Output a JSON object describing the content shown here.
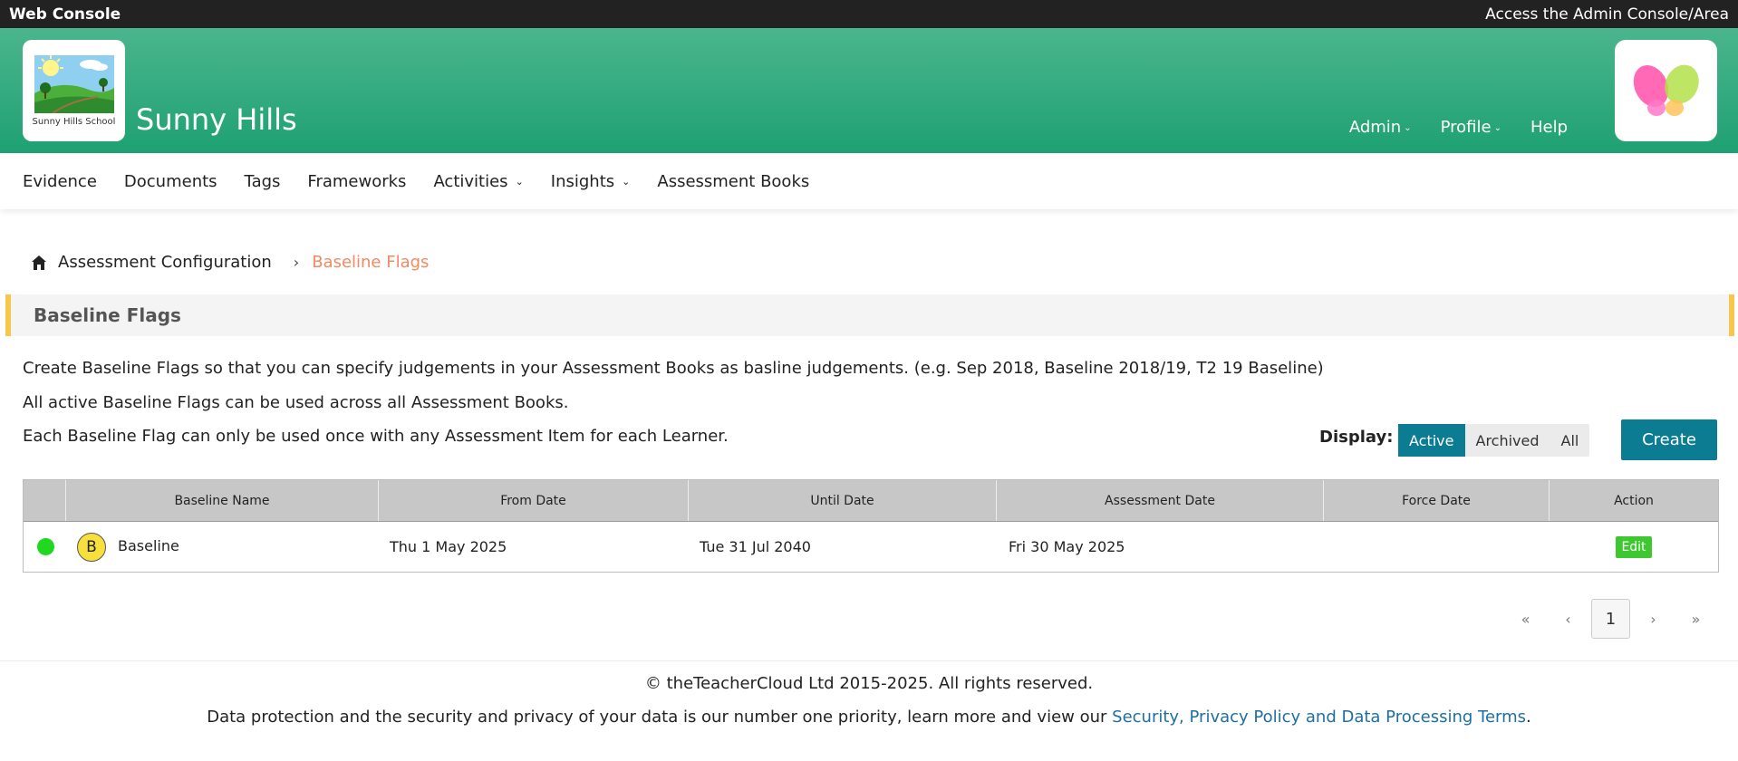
{
  "topbar": {
    "left_label": "Web Console",
    "right_link": "Access the Admin Console/Area"
  },
  "header": {
    "logo_caption": "Sunny Hills School",
    "school_name": "Sunny Hills",
    "nav": [
      {
        "label": "Admin",
        "icon": "chevron-down-icon"
      },
      {
        "label": "Profile",
        "icon": "chevron-down-icon"
      },
      {
        "label": "Help"
      }
    ],
    "brand_icon": "butterfly-logo-icon"
  },
  "main_nav": [
    {
      "label": "Evidence"
    },
    {
      "label": "Documents"
    },
    {
      "label": "Tags"
    },
    {
      "label": "Frameworks"
    },
    {
      "label": "Activities",
      "icon": "chevron-down-icon"
    },
    {
      "label": "Insights",
      "icon": "chevron-down-icon"
    },
    {
      "label": "Assessment Books"
    }
  ],
  "breadcrumb": {
    "home_icon": "home-icon",
    "parent": "Assessment Configuration",
    "separator": "›",
    "current": "Baseline Flags"
  },
  "panel": {
    "title": "Baseline Flags"
  },
  "description": [
    "Create Baseline Flags so that you can specify judgements in your Assessment Books as basline judgements. (e.g. Sep 2018, Baseline 2018/19, T2 19 Baseline)",
    "All active Baseline Flags can be used across all Assessment Books.",
    "Each Baseline Flag can only be used once with any Assessment Item for each Learner."
  ],
  "display_filter": {
    "label": "Display:",
    "options": [
      "Active",
      "Archived",
      "All"
    ],
    "selected": "Active"
  },
  "create_label": "Create",
  "table": {
    "columns": [
      "",
      "Baseline Name",
      "From Date",
      "Until Date",
      "Assessment Date",
      "Force Date",
      "Action"
    ],
    "rows": [
      {
        "status_color": "#1fd81f",
        "badge": "B",
        "name": "Baseline",
        "from": "Thu 1 May 2025",
        "until": "Tue 31 Jul 2040",
        "assessment": "Fri 30 May 2025",
        "force": "",
        "action": "Edit"
      }
    ]
  },
  "pagination": {
    "first": "«",
    "prev": "‹",
    "current": "1",
    "next": "›",
    "last": "»"
  },
  "footer": {
    "copyright": "© theTeacherCloud Ltd 2015-2025. All rights reserved.",
    "privacy_text": "Data protection and the security and privacy of your data is our number one priority, learn more and view our ",
    "privacy_link": "Security, Privacy Policy and Data Processing Terms",
    "privacy_end": "."
  },
  "colors": {
    "header_green": "#1ea173",
    "accent_teal": "#0c7c93",
    "breadcrumb_current": "#f08a62",
    "panel_border": "#f6c64d",
    "edit_green": "#3dc82f"
  }
}
